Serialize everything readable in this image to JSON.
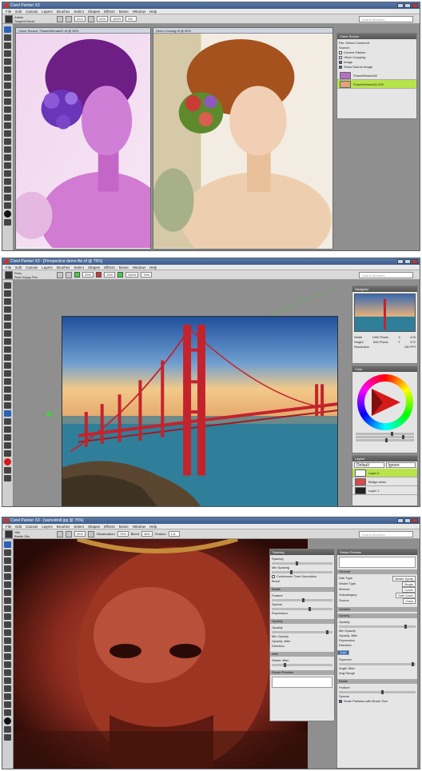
{
  "app": {
    "title1": "Corel Painter X3",
    "title2": "Corel Painter X3 - [Perspective demo file.rif @ 75%]",
    "title3": "Corel Painter X3 - [samodroll.jpg @ 75%]"
  },
  "menu": [
    "File",
    "Edit",
    "Canvas",
    "Layers",
    "Brushes",
    "Select",
    "Shapes",
    "Effects",
    "Movie",
    "Window",
    "Help"
  ],
  "search_placeholder": "Search Brushes",
  "shot1": {
    "brush_cat": "Artists",
    "brush_var": "Sargent Brush",
    "size": "20.0",
    "opacity": "22%",
    "grain": "100%",
    "blend": "5%",
    "doc_left_title": "Clone Source: FlowerWoman01.rif @ 50%",
    "doc_right_title": "Demo Cloning.rif @ 50%",
    "clone_panel": {
      "title": "Clone Source",
      "line1": "File: Select Cloned.rif",
      "source_label": "Source:",
      "opt_current": "Current Pattern",
      "opt_other": "Other Cropping",
      "opt_image": "Image",
      "show_source": "Show Source Image",
      "sources": [
        "FlowerWoman02",
        "FlowerWoman01 002"
      ]
    },
    "colors": {
      "accent": "#a8d93a"
    }
  },
  "shot2": {
    "brush_cat": "Pens",
    "brush_var": "Real Drippy Pen",
    "opacity_a": "20%",
    "opacity_b": "13%",
    "opacity_c": "100%",
    "density": "75%",
    "navigator": {
      "title": "Navigator",
      "width_label": "Width",
      "width_val": "1000 Pixels",
      "height_label": "Height",
      "height_val": "600 Pixels",
      "res_label": "Resolution",
      "res_val": "150 PPI",
      "x_label": "X",
      "x_val": "476",
      "y_label": "Y",
      "y_val": "272"
    },
    "color_panel": {
      "title": "Color"
    },
    "layers": {
      "title": "Layers",
      "blend": "Default",
      "comp": "Ignore",
      "items": [
        "Layer 2",
        "Bridge wires",
        "Layer 1"
      ]
    }
  },
  "shot3": {
    "brush_cat": "Oils",
    "brush_var": "Bristle Oils",
    "size": "30.6",
    "resaturation": "70%",
    "bleed": "45%",
    "feature": "1.8",
    "dab": {
      "title": "Spacing",
      "spacing": "Spacing",
      "min_spacing": "Min Spacing",
      "continuous": "Continuous Time Deposition",
      "boost": "Boost",
      "bristle": "Bristle",
      "feature": "Feature",
      "spread": "Spread",
      "expression": "Expression",
      "opacity_section": "Opacity",
      "opacity": "Opacity",
      "min_opacity": "Min Opacity",
      "opacity_jitter": "Opacity Jitter",
      "direction": "Direction",
      "well": "Well",
      "stroke_jitter": "Stroke Jitter",
      "stroke_preview": "Stroke Preview"
    },
    "general": {
      "title": "Stroke Preview",
      "section": "General",
      "dab_type": "Dab Type",
      "dab_type_val": "Bristle Spray",
      "stroke_type": "Stroke Type",
      "stroke_type_val": "Single",
      "method": "Method",
      "method_val": "Cover",
      "subcategory": "Subcategory",
      "subcategory_val": "Soft Cover",
      "source": "Source",
      "source_val": "Color",
      "variants": "Variants",
      "opacity_section": "Opacity",
      "opacity": "Opacity",
      "min_opacity": "Min Opacity",
      "opacity_jitter": "Opacity Jitter",
      "expression": "Expression",
      "direction": "Direction",
      "angle": "Angle",
      "squeeze": "Squeeze",
      "angle_jitter": "Angle Jitter",
      "ang_range": "Ang Range",
      "bristle": "Bristle",
      "feature": "Feature",
      "spread": "Spread",
      "scale": "Scale Particles with Brush Size"
    }
  }
}
